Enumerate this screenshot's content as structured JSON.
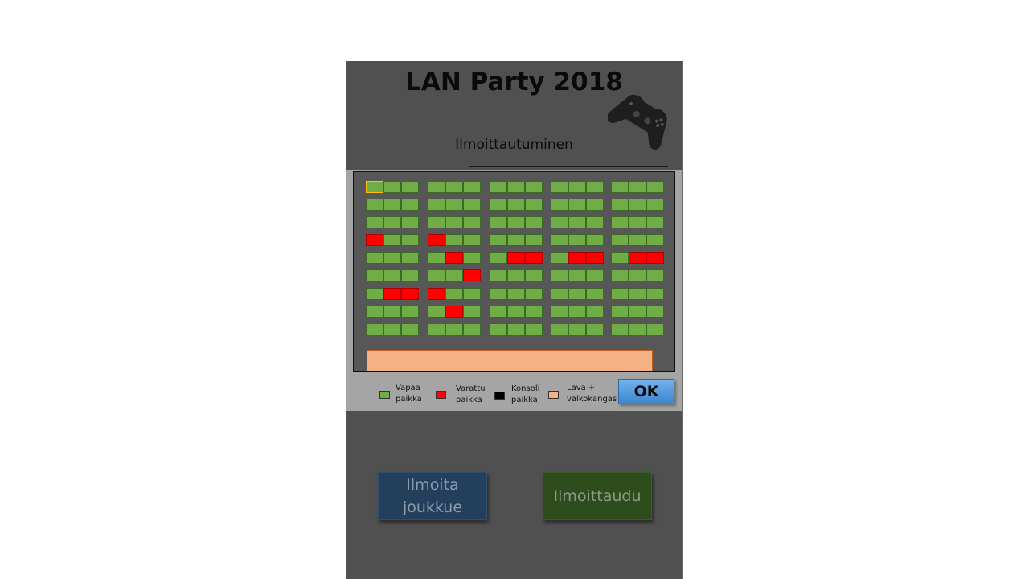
{
  "header": {
    "title": "LAN Party 2018",
    "subtitle": "Ilmoittautuminen"
  },
  "icons": {
    "controller": "game-controller-icon"
  },
  "colors": {
    "free": "#70ad47",
    "reserved": "#ff0000",
    "console": "#000000",
    "stage": "#f4b183",
    "ok": "#5b9bd5",
    "team_button": "#233f5c",
    "signup_button": "#2e4d1d"
  },
  "seat_map": {
    "columns": 5,
    "rows": 9,
    "seats_per_group": 3,
    "selected_seat": [
      0,
      0,
      0
    ],
    "reserved": [
      [
        0,
        3,
        0
      ],
      [
        0,
        6,
        1
      ],
      [
        0,
        6,
        2
      ],
      [
        1,
        3,
        0
      ],
      [
        1,
        4,
        1
      ],
      [
        1,
        5,
        2
      ],
      [
        1,
        6,
        0
      ],
      [
        1,
        7,
        1
      ],
      [
        2,
        4,
        1
      ],
      [
        2,
        4,
        2
      ],
      [
        3,
        4,
        1
      ],
      [
        3,
        4,
        2
      ],
      [
        4,
        4,
        1
      ],
      [
        4,
        4,
        2
      ]
    ]
  },
  "legend": {
    "free": "Vapaa\npaikka",
    "reserved": "Varattu\npaikka",
    "console": "Konsoli\npaikka",
    "stage": "Lava +\nvalkokangas"
  },
  "buttons": {
    "ok": "OK",
    "team": "Ilmoita\njoukkue",
    "signup": "Ilmoittaudu"
  }
}
